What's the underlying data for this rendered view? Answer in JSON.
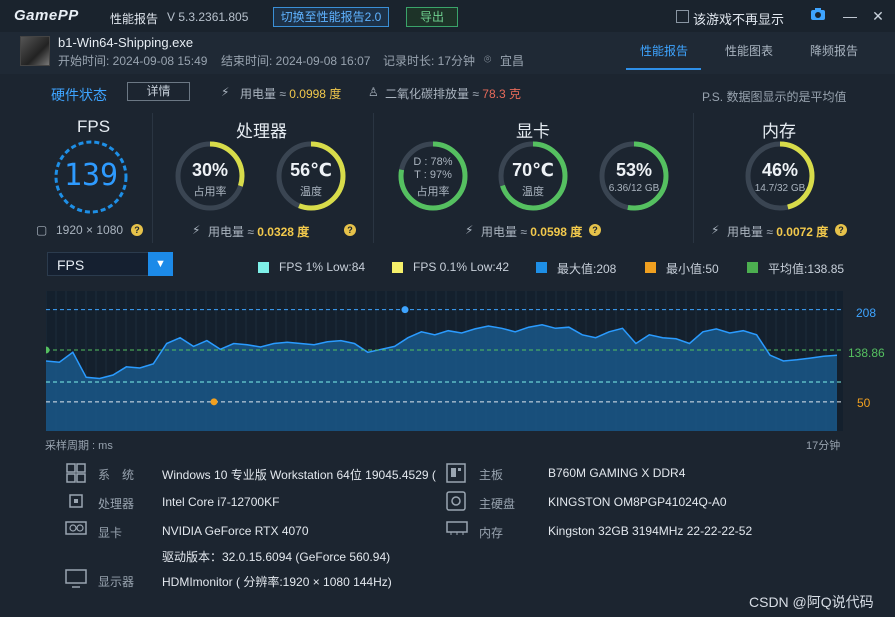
{
  "titlebar": {
    "brand": "GamePP",
    "app_name": "性能报告",
    "version": "V 5.3.2361.805",
    "switch_button": "切换至性能报告2.0",
    "export_button": "导出",
    "no_show_label": "该游戏不再显示"
  },
  "header": {
    "exe_name": "b1-Win64-Shipping.exe",
    "start_time": "开始时间: 2024-09-08 15:49",
    "end_time": "结束时间: 2024-09-08 16:07",
    "duration": "记录时长: 17分钟",
    "location": "宜昌",
    "tabs": [
      "性能报告",
      "性能图表",
      "降频报告"
    ]
  },
  "status": {
    "title": "硬件状态",
    "detail_button": "详情",
    "power_label": "用电量 ≈",
    "power_value": "0.0998 度",
    "co2_label": "二氧化碳排放量 ≈",
    "co2_value": "78.3 克",
    "note": "P.S. 数据图显示的是平均值"
  },
  "fps": {
    "title": "FPS",
    "value": "139",
    "resolution": "1920 × 1080"
  },
  "cpu": {
    "title": "处理器",
    "usage": "30%",
    "usage_label": "占用率",
    "usage_fraction": 0.3,
    "temp": "56℃",
    "temp_label": "温度",
    "temp_fraction": 0.56,
    "power_label": "用电量 ≈",
    "power_value": "0.0328 度"
  },
  "gpu": {
    "title": "显卡",
    "d_line": "D : 78%",
    "t_line": "T : 97%",
    "usage_label": "占用率",
    "usage_fraction": 0.78,
    "temp": "70℃",
    "temp_label": "温度",
    "temp_fraction": 0.7,
    "vram": "53%",
    "vram_sub": "6.36/12 GB",
    "vram_fraction": 0.53,
    "power_label": "用电量 ≈",
    "power_value": "0.0598 度"
  },
  "mem": {
    "title": "内存",
    "usage": "46%",
    "usage_sub": "14.7/32 GB",
    "usage_fraction": 0.46,
    "power_label": "用电量 ≈",
    "power_value": "0.0072 度"
  },
  "chart_controls": {
    "selected": "FPS",
    "legend": [
      {
        "label": "FPS 1% Low:84",
        "color": "#7ef0e8"
      },
      {
        "label": "FPS 0.1% Low:42",
        "color": "#f5f06a"
      },
      {
        "label": "最大值:208",
        "color": "#1e8fe6"
      },
      {
        "label": "最小值:50",
        "color": "#f0a020"
      },
      {
        "label": "平均值:138.85",
        "color": "#4caf50"
      }
    ],
    "sample_label": "采样周期 : ms",
    "duration_label": "17分钟"
  },
  "chart_data": {
    "type": "area",
    "series": [
      {
        "name": "FPS",
        "values": [
          120,
          118,
          135,
          92,
          90,
          96,
          110,
          108,
          115,
          150,
          160,
          145,
          155,
          140,
          150,
          148,
          144,
          150,
          152,
          150,
          148,
          153,
          155,
          150,
          135,
          140,
          145,
          160,
          170,
          165,
          172,
          168,
          175,
          180,
          176,
          170,
          178,
          182,
          176,
          178,
          165,
          160,
          170,
          176,
          150,
          165,
          160,
          158,
          150,
          170,
          175,
          168,
          172,
          165,
          130,
          120,
          122,
          125,
          128,
          130
        ]
      }
    ],
    "max": 208,
    "min": 50,
    "avg": 138.85,
    "low1": 84,
    "low01": 42,
    "ticks": [
      "208",
      "138.86",
      "50"
    ],
    "ylim": [
      0,
      240
    ]
  },
  "info": {
    "system_key": "系　统",
    "system_val": "Windows 10 专业版 Workstation 64位 19045.4529 (",
    "cpu_key": "处理器",
    "cpu_val": "Intel Core i7-12700KF",
    "gpu_key": "显卡",
    "gpu_val": "NVIDIA GeForce RTX 4070",
    "driver_val": "驱动版本：32.0.15.6094 (GeForce 560.94)",
    "monitor_key": "显示器",
    "monitor_val": "HDMImonitor ( 分辨率:1920 × 1080 144Hz)",
    "board_key": "主板",
    "board_val": "B760M GAMING X DDR4",
    "disk_key": "主硬盘",
    "disk_val": "KINGSTON OM8PGP41024Q-A0",
    "mem_key": "内存",
    "mem_val": "Kingston 32GB 3194MHz 22-22-22-52"
  },
  "watermark": "CSDN @阿Q说代码"
}
